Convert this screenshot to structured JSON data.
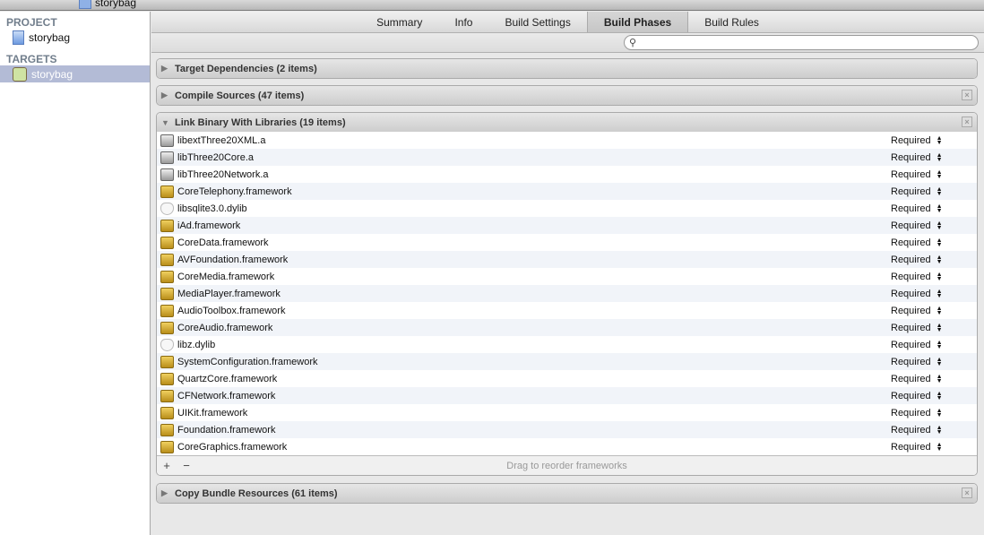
{
  "toolbar": {
    "project": "storybag"
  },
  "sidebar": {
    "project_header": "PROJECT",
    "project_item": "storybag",
    "targets_header": "TARGETS",
    "target_item": "storybag"
  },
  "tabs": [
    "Summary",
    "Info",
    "Build Settings",
    "Build Phases",
    "Build Rules"
  ],
  "active_tab": "Build Phases",
  "search": {
    "value": ""
  },
  "phases": {
    "target_deps": "Target Dependencies (2 items)",
    "compile": "Compile Sources (47 items)",
    "link": "Link Binary With Libraries (19 items)",
    "copy": "Copy Bundle Resources (61 items)"
  },
  "libraries": [
    {
      "name": "libextThree20XML.a",
      "type": "lib",
      "status": "Required"
    },
    {
      "name": "libThree20Core.a",
      "type": "lib",
      "status": "Required"
    },
    {
      "name": "libThree20Network.a",
      "type": "lib",
      "status": "Required"
    },
    {
      "name": "CoreTelephony.framework",
      "type": "fw",
      "status": "Required"
    },
    {
      "name": "libsqlite3.0.dylib",
      "type": "dylib",
      "status": "Required"
    },
    {
      "name": "iAd.framework",
      "type": "fw",
      "status": "Required"
    },
    {
      "name": "CoreData.framework",
      "type": "fw",
      "status": "Required"
    },
    {
      "name": "AVFoundation.framework",
      "type": "fw",
      "status": "Required"
    },
    {
      "name": "CoreMedia.framework",
      "type": "fw",
      "status": "Required"
    },
    {
      "name": "MediaPlayer.framework",
      "type": "fw",
      "status": "Required"
    },
    {
      "name": "AudioToolbox.framework",
      "type": "fw",
      "status": "Required"
    },
    {
      "name": "CoreAudio.framework",
      "type": "fw",
      "status": "Required"
    },
    {
      "name": "libz.dylib",
      "type": "dylib",
      "status": "Required"
    },
    {
      "name": "SystemConfiguration.framework",
      "type": "fw",
      "status": "Required"
    },
    {
      "name": "QuartzCore.framework",
      "type": "fw",
      "status": "Required"
    },
    {
      "name": "CFNetwork.framework",
      "type": "fw",
      "status": "Required"
    },
    {
      "name": "UIKit.framework",
      "type": "fw",
      "status": "Required"
    },
    {
      "name": "Foundation.framework",
      "type": "fw",
      "status": "Required"
    },
    {
      "name": "CoreGraphics.framework",
      "type": "fw",
      "status": "Required"
    }
  ],
  "footer": {
    "add": "+",
    "remove": "−",
    "hint": "Drag to reorder frameworks"
  }
}
